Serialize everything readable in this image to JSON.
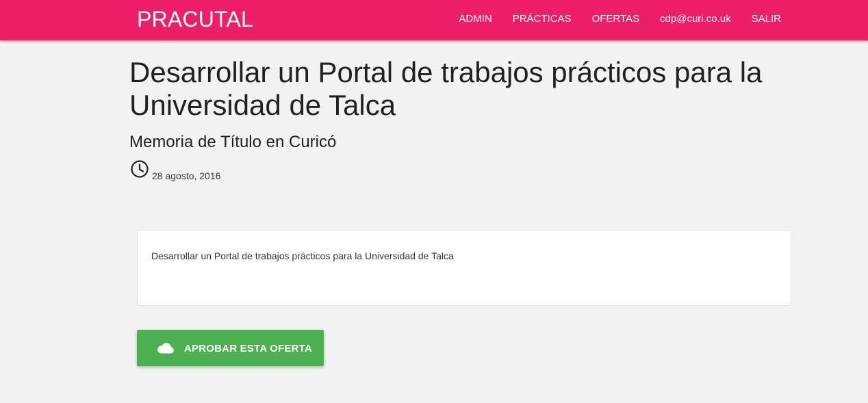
{
  "navbar": {
    "brand": "PRACUTAL",
    "links": [
      {
        "label": "ADMIN",
        "icon": null
      },
      {
        "label": "PRÁCTICAS",
        "icon": null
      },
      {
        "label": "OFERTAS",
        "icon": null
      },
      {
        "label": "cdp@curi.co.uk",
        "icon": null
      },
      {
        "label": "SALIR",
        "icon": null
      }
    ],
    "color": "#ec1f67"
  },
  "offer": {
    "title": "Desarrollar un Portal de trabajos prácticos para la Universidad de Talca",
    "subtitle": "Memoria de Título en Curicó",
    "date_icon": "clock-icon",
    "date": "28 agosto, 2016",
    "description": "Desarrollar un Portal de trabajos prácticos para la Universidad de Talca"
  },
  "actions": {
    "approve_label": "APROBAR ESTA OFERTA",
    "approve_icon": "cloud-icon",
    "approve_color": "#4caf50"
  }
}
